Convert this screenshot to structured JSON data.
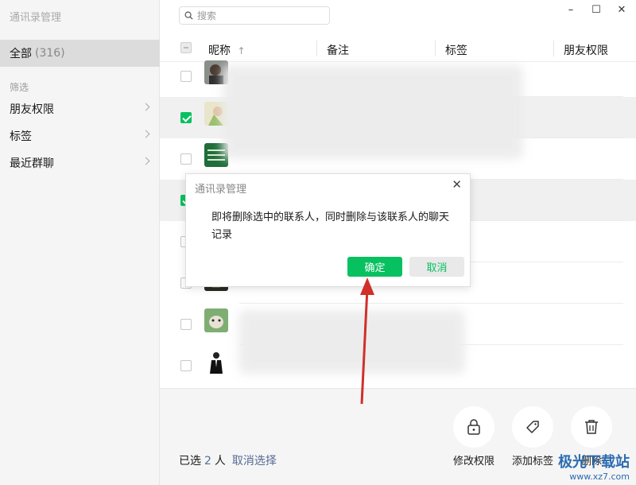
{
  "app": {
    "title": "通讯录管理"
  },
  "sidebar": {
    "all_label": "全部",
    "all_count": "(316)",
    "filter_label": "筛选",
    "items": [
      {
        "label": "朋友权限"
      },
      {
        "label": "标签"
      },
      {
        "label": "最近群聊"
      }
    ]
  },
  "search": {
    "placeholder": "搜索"
  },
  "window": {
    "minimize": "–",
    "maximize": "☐",
    "close": "✕"
  },
  "table": {
    "columns": [
      "昵称",
      "备注",
      "标签",
      "朋友权限"
    ],
    "sort_indicator": "↑",
    "rows": [
      {
        "checked": false,
        "avatar": "man-avatar"
      },
      {
        "checked": true,
        "avatar": "girl-avatar"
      },
      {
        "checked": false,
        "avatar": "green-sign-avatar"
      },
      {
        "checked": true,
        "avatar": "hidden"
      },
      {
        "checked": false,
        "avatar": "hidden"
      },
      {
        "checked": false,
        "avatar": "hidden"
      },
      {
        "checked": false,
        "avatar": "bird-avatar"
      },
      {
        "checked": false,
        "avatar": "suit-avatar"
      }
    ]
  },
  "bottom": {
    "selected_prefix": "已选",
    "selected_count": "2",
    "selected_suffix": "人",
    "deselect": "取消选择",
    "actions": [
      {
        "label": "修改权限",
        "icon": "lock-icon"
      },
      {
        "label": "添加标签",
        "icon": "tag-icon"
      },
      {
        "label": "删除",
        "icon": "trash-icon"
      }
    ]
  },
  "dialog": {
    "title": "通讯录管理",
    "message": "即将删除选中的联系人，同时删除与该联系人的聊天记录",
    "confirm": "确定",
    "cancel": "取消"
  },
  "watermark": {
    "text": "极光下载站",
    "url": "www.xz7.com"
  },
  "colors": {
    "accent": "#07c160",
    "link": "#576b95",
    "arrow": "#d0302a"
  }
}
